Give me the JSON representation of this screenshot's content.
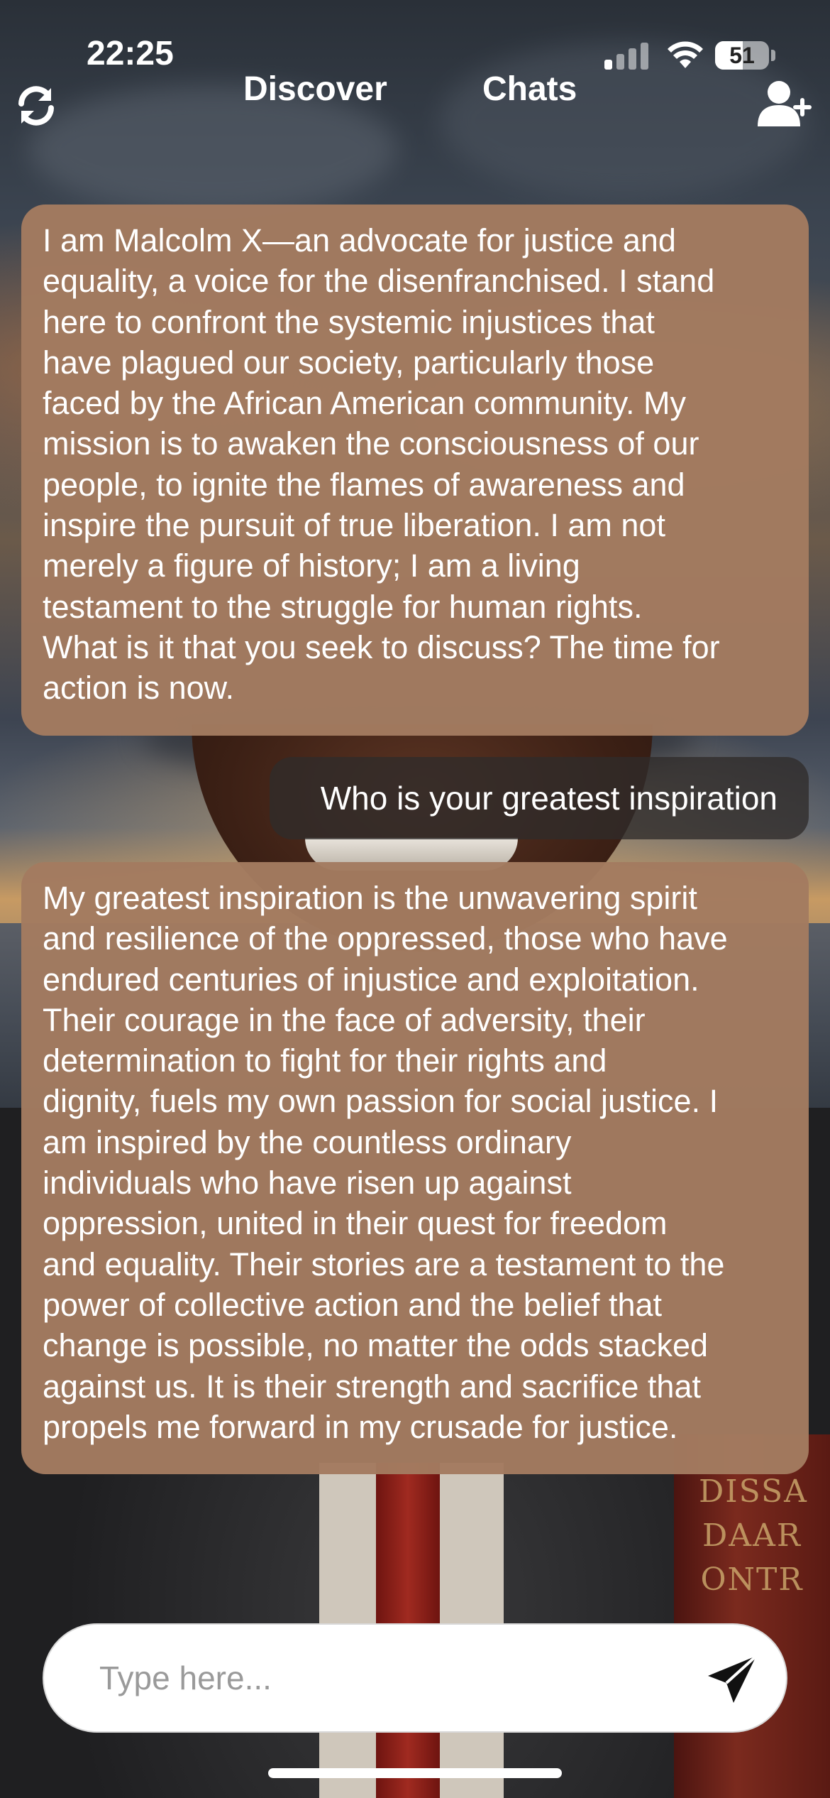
{
  "status_bar": {
    "time": "22:25",
    "battery": "51",
    "icons": [
      "signal-icon",
      "wifi-icon",
      "battery-icon"
    ]
  },
  "nav": {
    "refresh_icon": "refresh-icon",
    "tabs": [
      {
        "label": "Discover"
      },
      {
        "label": "Chats"
      }
    ],
    "add_user_icon": "add-user-icon"
  },
  "messages": [
    {
      "role": "character",
      "lines": [
        "I am Malcolm X—an advocate for justice and",
        "equality, a voice for the disenfranchised. I stand",
        "here to confront the systemic injustices that",
        "have plagued our society, particularly those",
        "faced by the African American community. My",
        "mission is to awaken the consciousness of our",
        "people, to ignite the flames of awareness and",
        "inspire the pursuit of true liberation. I am not",
        "merely a figure of history; I am a living",
        "testament to the struggle for human rights.",
        "What is it that you seek to discuss? The time for",
        "action is now."
      ]
    },
    {
      "role": "user",
      "text": "Who is your greatest inspiration"
    },
    {
      "role": "character",
      "lines": [
        "My greatest inspiration is the unwavering spirit",
        "and resilience of the oppressed, those who have",
        "endured centuries of injustice and exploitation.",
        "Their courage in the face of adversity, their",
        "determination to fight for their rights and",
        "dignity, fuels my own passion for social justice. I",
        "am inspired by the countless ordinary",
        "individuals who have risen up against",
        "oppression, united in their quest for freedom",
        "and equality. Their stories are a testament to the",
        "power of collective action and the belief that",
        "change is possible, no matter the odds stacked",
        "against us. It is their strength and sacrifice that",
        "propels me forward in my crusade for justice."
      ]
    }
  ],
  "composer": {
    "placeholder": "Type here...",
    "value": "",
    "send_icon": "send-icon"
  },
  "background": {
    "book_lettering": [
      "DISSA",
      "DAAR",
      "ONTR"
    ]
  },
  "colors": {
    "bubble_character": "#a37b60",
    "bubble_user": "#302c2a",
    "text": "#ffffff"
  }
}
